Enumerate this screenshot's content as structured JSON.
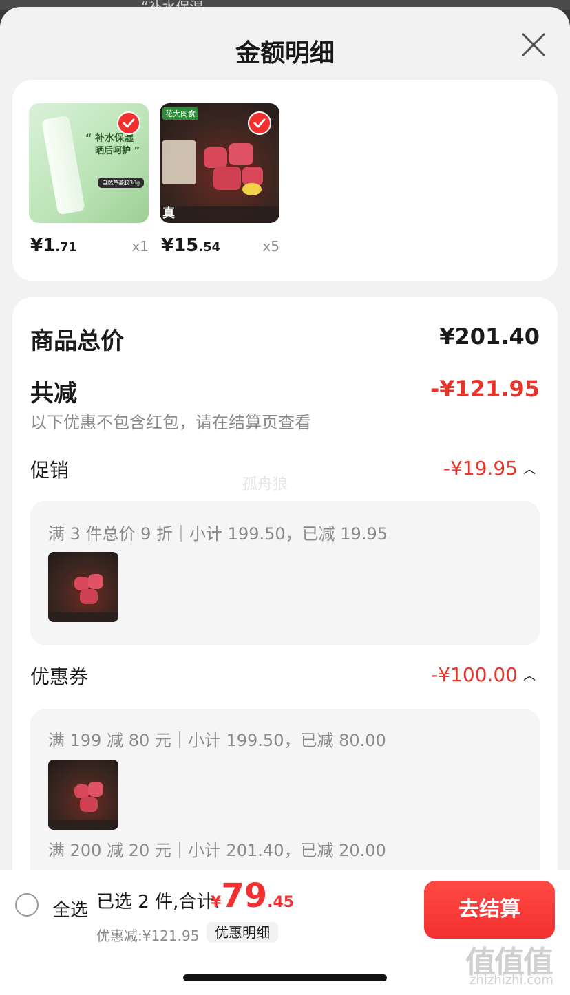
{
  "backdrop": {
    "text": "“补水保湿"
  },
  "sheet": {
    "title": "金额明细"
  },
  "products": [
    {
      "price_int": "¥1",
      "price_dec": ".71",
      "qty": "x1",
      "checked": true,
      "image": "aloe-vera-gel",
      "image_text": {
        "line1": "“ 补水保湿",
        "line2": "晒后呵护 ”",
        "tag": "自然芦荟胶30g"
      }
    },
    {
      "price_int": "¥15",
      "price_dec": ".54",
      "qty": "x5",
      "checked": true,
      "image": "beef-ribs",
      "image_text": {
        "logo": "花大肉食",
        "zhen": "真"
      }
    }
  ],
  "summary": {
    "total_label": "商品总价",
    "total_value": "¥201.40",
    "reduce_label": "共减",
    "reduce_value": "-¥121.95",
    "note": "以下优惠不包含红包，请在结算页查看"
  },
  "promotion": {
    "label": "促销",
    "amount": "-¥19.95",
    "rules": [
      {
        "desc": "满 3 件总价 9 折｜小计 199.50，已减 19.95"
      }
    ]
  },
  "coupon": {
    "label": "优惠券",
    "amount": "-¥100.00",
    "rules": [
      {
        "desc": "满 199 减 80 元｜小计 199.50，已减 80.00"
      },
      {
        "desc": "满 200 减 20 元｜小计 201.40，已减 20.00"
      }
    ]
  },
  "watermark": "孤舟狼",
  "bottom_bar": {
    "select_all": "全选",
    "selected_text": "已选 2 件,合计:",
    "total_symbol": "¥",
    "total_int": "79",
    "total_dec": ".45",
    "discount_text": "优惠减:¥121.95",
    "detail_chip": "优惠明细",
    "checkout": "去结算"
  },
  "site": {
    "mark": "值值值",
    "url": "zhizhizhi.com"
  },
  "colors": {
    "accent": "#f23030",
    "reduce": "#e8352c"
  }
}
